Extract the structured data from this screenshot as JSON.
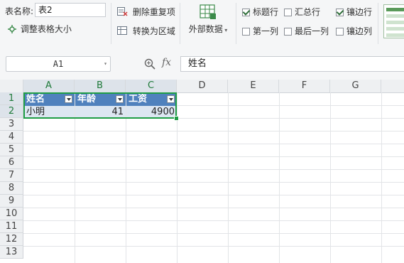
{
  "ribbon": {
    "table_name_label": "表名称:",
    "table_name_value": "表2",
    "resize_table": "调整表格大小",
    "remove_duplicates": "删除重复项",
    "convert_to_range": "转换为区域",
    "external_data": "外部数据",
    "options": [
      {
        "label": "标题行",
        "checked": true
      },
      {
        "label": "汇总行",
        "checked": false
      },
      {
        "label": "镶边行",
        "checked": true
      },
      {
        "label": "第一列",
        "checked": false
      },
      {
        "label": "最后一列",
        "checked": false
      },
      {
        "label": "镶边列",
        "checked": false
      }
    ]
  },
  "formula_bar": {
    "cell_ref": "A1",
    "fx": "fx",
    "content": "姓名"
  },
  "sheet": {
    "columns": [
      "A",
      "B",
      "C",
      "D",
      "E",
      "F",
      "G"
    ],
    "rows": [
      "1",
      "2",
      "3",
      "4",
      "5",
      "6",
      "7",
      "8",
      "9",
      "10",
      "11",
      "12",
      "13"
    ],
    "table_headers": [
      "姓名",
      "年龄",
      "工资"
    ],
    "table_row": [
      "小明",
      "41",
      "4900"
    ]
  }
}
